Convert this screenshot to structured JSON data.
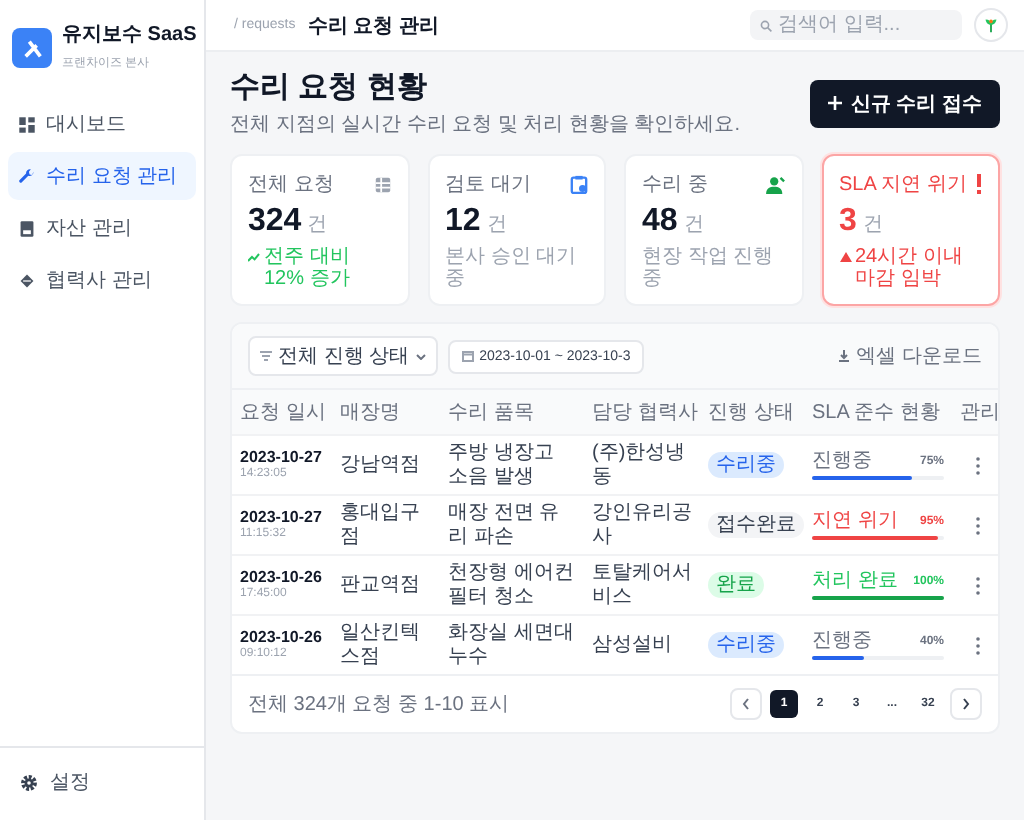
{
  "sidebar": {
    "brand": {
      "name": "유지보수 SaaS",
      "subtitle": "프랜차이즈 본사"
    },
    "items": [
      {
        "label": "대시보드",
        "kind": "dashboard",
        "selected": false
      },
      {
        "label": "수리 요청 관리",
        "kind": "repair",
        "selected": true
      },
      {
        "label": "자산 관리",
        "kind": "asset",
        "selected": false
      },
      {
        "label": "협력사 관리",
        "kind": "partner",
        "selected": false
      }
    ],
    "footer": {
      "label": "설정"
    }
  },
  "topbar": {
    "breadcrumb_path": "/ requests",
    "breadcrumb_current": "수리 요청 관리",
    "search": {
      "placeholder": "검색어 입력..."
    }
  },
  "header": {
    "title": "수리 요청 현황",
    "subtitle": "전체 지점의 실시간 수리 요청 및 처리 현황을 확인하세요.",
    "button": "신규 수리 접수"
  },
  "stats": [
    {
      "kind": "total",
      "label": "전체 요청",
      "value": "324",
      "unit": "건",
      "note": "전주 대비 12% 증가"
    },
    {
      "kind": "pending",
      "label": "검토 대기",
      "value": "12",
      "unit": "건",
      "note": "본사 승인 대기중"
    },
    {
      "kind": "progress",
      "label": "수리 중",
      "value": "48",
      "unit": "건",
      "note": "현장 작업 진행중"
    },
    {
      "kind": "alert",
      "label": "SLA 지연 위기",
      "value": "3",
      "unit": "건",
      "note": "24시간 이내 마감 임박"
    }
  ],
  "filters": {
    "status": "전체 진행 상태",
    "date_range": "2023-10-01 ~ 2023-10-3",
    "export": "엑셀 다운로드"
  },
  "table": {
    "columns": [
      "요청 일시",
      "매장명",
      "수리 품목",
      "담당 협력사",
      "진행 상태",
      "SLA 준수 현황",
      "관리"
    ],
    "rows": [
      {
        "date": "2023-10-27",
        "time": "14:23:05",
        "store": "강남역점",
        "item": "주방 냉장고 소음 발생",
        "vendor": "(주)한성냉동",
        "status": {
          "kind": "repairing",
          "label": "수리중"
        },
        "sla": {
          "kind": "normal",
          "label": "진행중",
          "percent": "75%",
          "level": 0.75
        }
      },
      {
        "date": "2023-10-27",
        "time": "11:15:32",
        "store": "홍대입구점",
        "item": "매장 전면 유리 파손",
        "vendor": "강인유리공사",
        "status": {
          "kind": "received",
          "label": "접수완료"
        },
        "sla": {
          "kind": "risk",
          "label": "지연 위기",
          "percent": "95%",
          "level": 0.95
        }
      },
      {
        "date": "2023-10-26",
        "time": "17:45:00",
        "store": "판교역점",
        "item": "천장형 에어컨 필터 청소",
        "vendor": "토탈케어서비스",
        "status": {
          "kind": "done",
          "label": "완료"
        },
        "sla": {
          "kind": "done",
          "label": "처리 완료",
          "percent": "100%",
          "level": 1
        }
      },
      {
        "date": "2023-10-26",
        "time": "09:10:12",
        "store": "일산킨텍스점",
        "item": "화장실 세면대 누수",
        "vendor": "삼성설비",
        "status": {
          "kind": "repairing",
          "label": "수리중"
        },
        "sla": {
          "kind": "normal",
          "label": "진행중",
          "percent": "40%",
          "level": 0.4
        }
      }
    ]
  },
  "pagination": {
    "summary": "전체 324개 요청 중 1-10 표시",
    "pages": [
      {
        "label": "1",
        "selected": true
      },
      {
        "label": "2",
        "selected": false
      },
      {
        "label": "3",
        "selected": false
      },
      {
        "label": "...",
        "selected": false
      },
      {
        "label": "32",
        "selected": false
      }
    ]
  }
}
